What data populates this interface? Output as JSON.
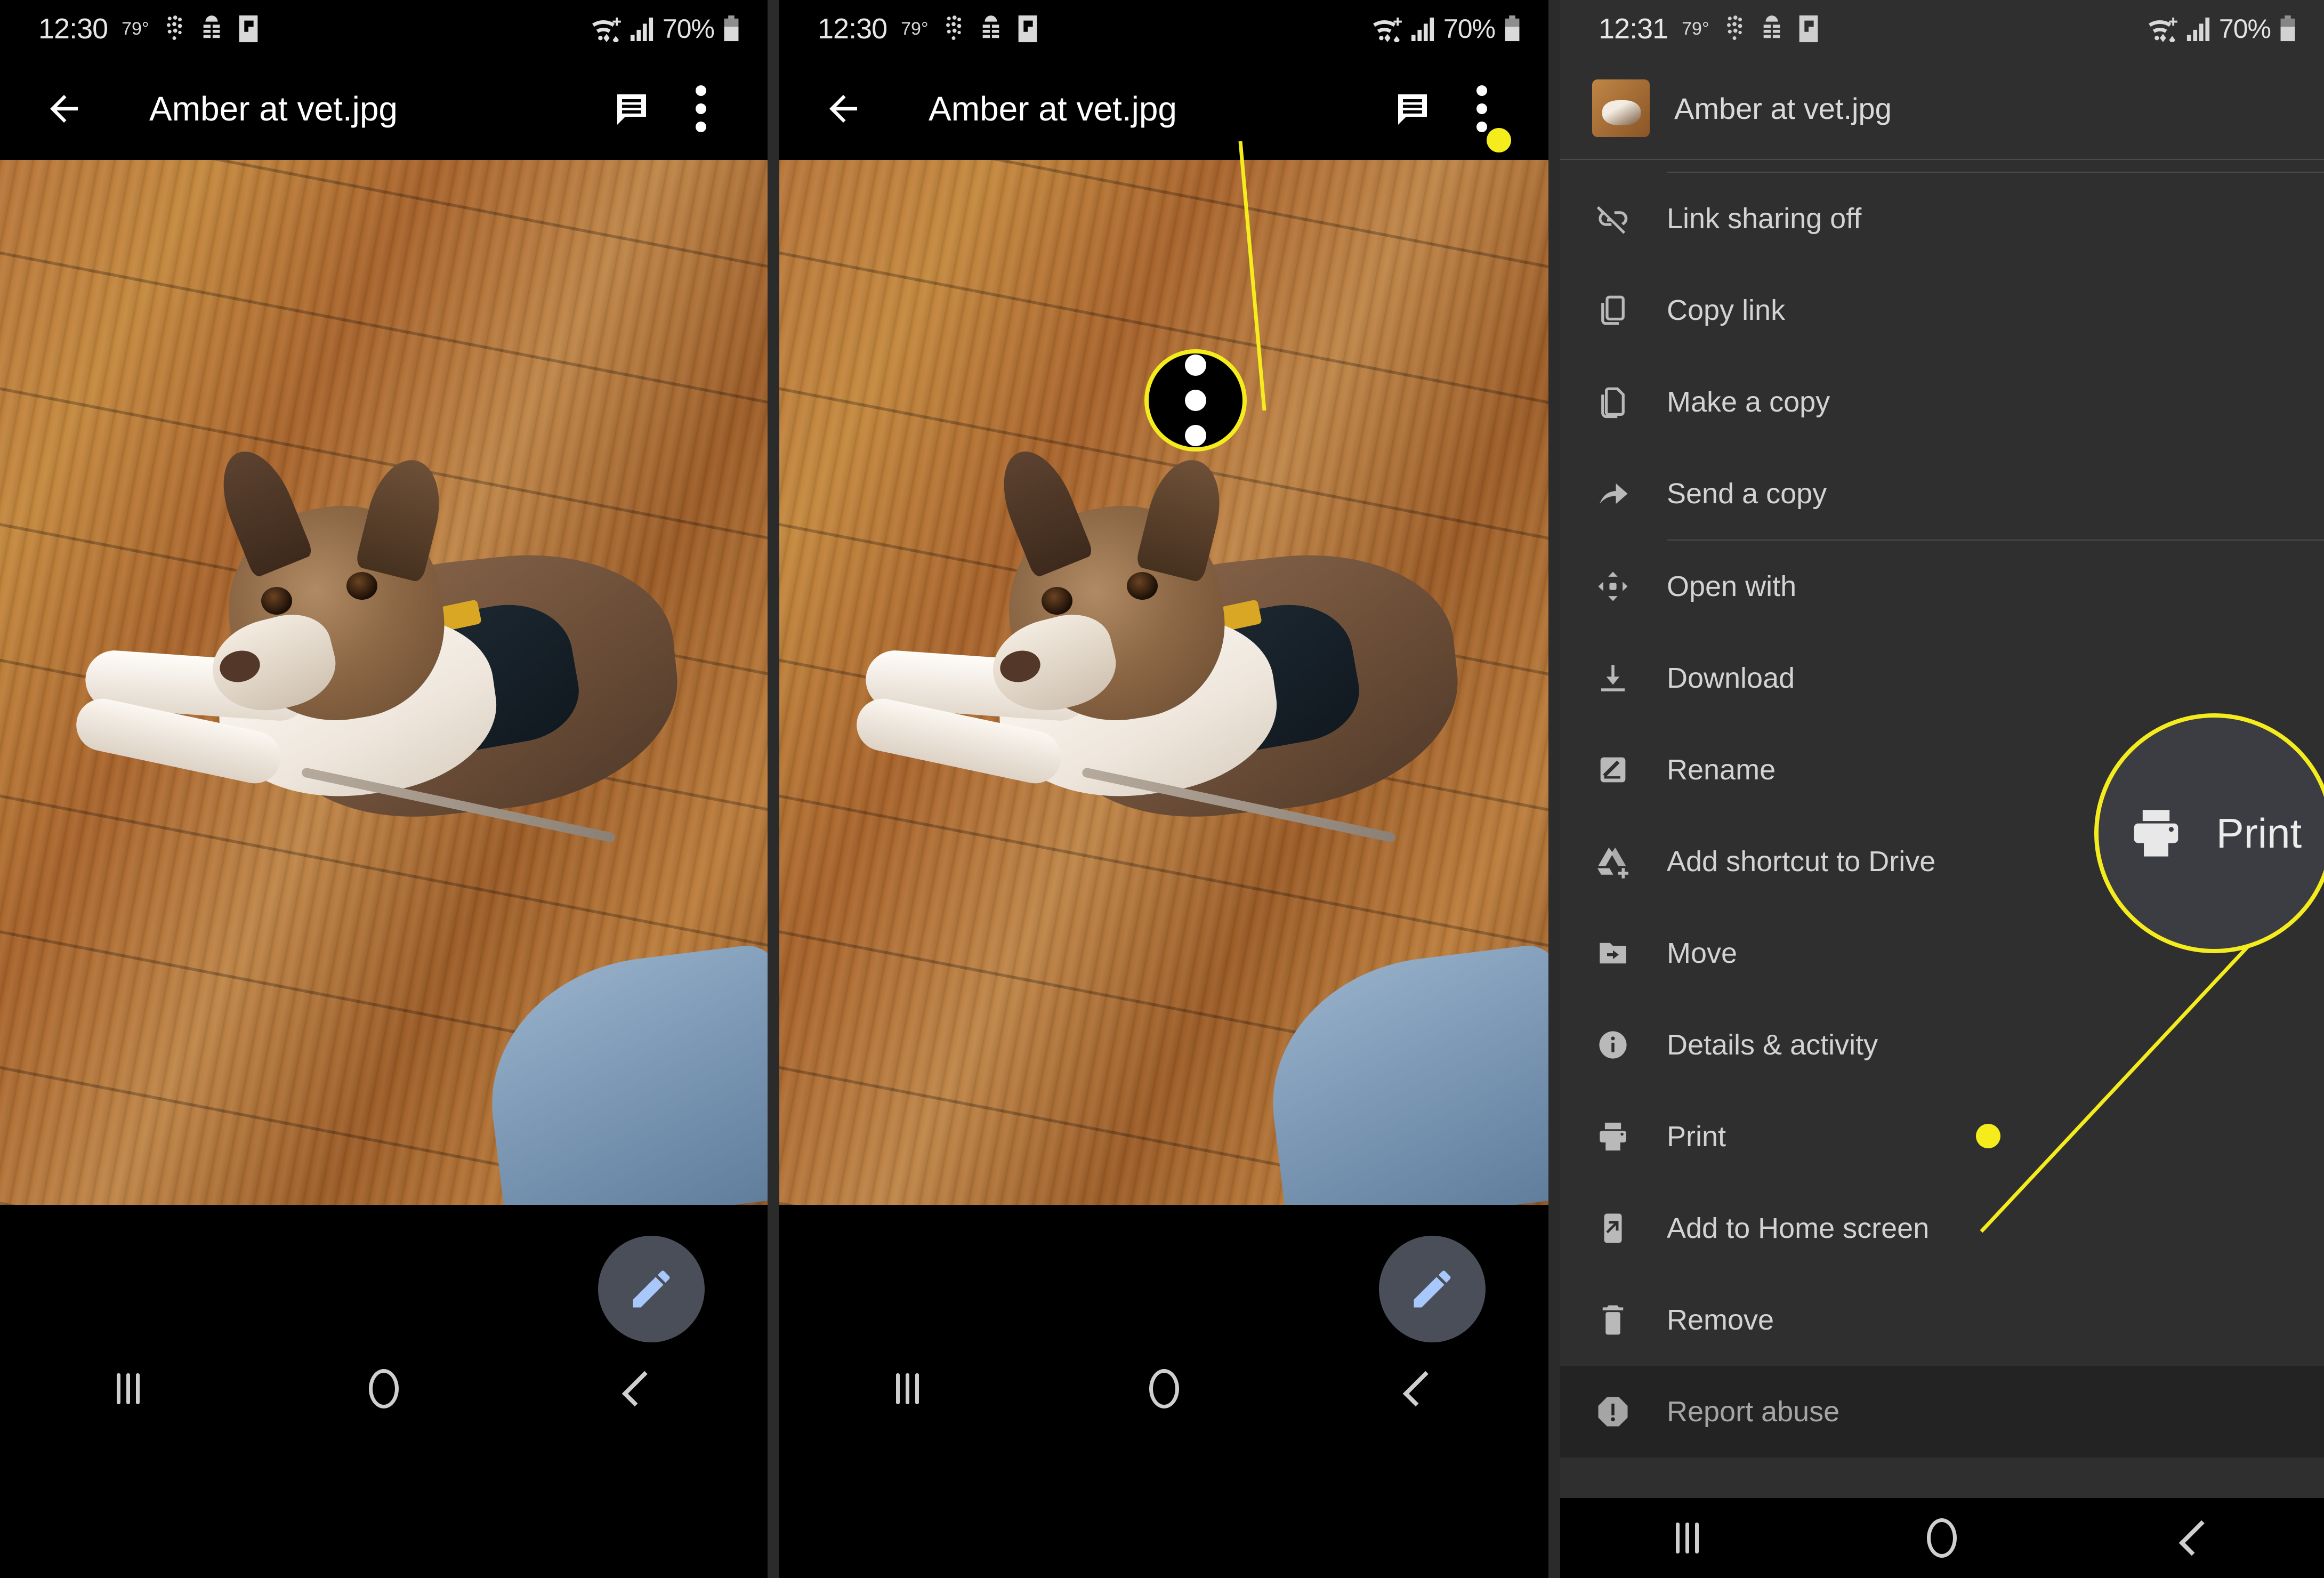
{
  "statusbar": {
    "time_panel1": "12:30",
    "time_panel2": "12:30",
    "time_panel3": "12:31",
    "temperature": "79°",
    "battery": "70%",
    "icons": [
      "braille-dots-icon",
      "android-robot-icon",
      "flipboard-icon",
      "wifi-icon",
      "cellular-signal-icon",
      "battery-icon"
    ]
  },
  "appbar": {
    "title": "Amber at vet.jpg",
    "back_label": "back-arrow",
    "comment_label": "comment",
    "overflow_label": "more-options"
  },
  "fab": {
    "label": "edit"
  },
  "navbar": {
    "recents": "recents",
    "home": "home",
    "back": "back"
  },
  "callouts": {
    "overflow": {
      "label": "more-options-highlight"
    },
    "print": {
      "label": "Print"
    }
  },
  "menu": {
    "header_title": "Amber at vet.jpg",
    "groups": [
      {
        "items": [
          {
            "label": "Link sharing off",
            "icon": "link-off-icon",
            "disabled": false
          },
          {
            "label": "Copy link",
            "icon": "copy-link-icon",
            "disabled": false
          },
          {
            "label": "Make a copy",
            "icon": "make-a-copy-icon",
            "disabled": false
          },
          {
            "label": "Send a copy",
            "icon": "send-a-copy-icon",
            "disabled": false
          }
        ]
      },
      {
        "items": [
          {
            "label": "Open with",
            "icon": "open-with-icon",
            "disabled": false
          },
          {
            "label": "Download",
            "icon": "download-icon",
            "disabled": false
          },
          {
            "label": "Rename",
            "icon": "rename-icon",
            "disabled": false
          },
          {
            "label": "Add shortcut to Drive",
            "icon": "add-shortcut-to-drive-icon",
            "disabled": false
          },
          {
            "label": "Move",
            "icon": "move-icon",
            "disabled": false
          },
          {
            "label": "Details & activity",
            "icon": "info-icon",
            "disabled": false
          },
          {
            "label": "Print",
            "icon": "print-icon",
            "disabled": false
          },
          {
            "label": "Add to Home screen",
            "icon": "add-to-home-screen-icon",
            "disabled": false
          },
          {
            "label": "Remove",
            "icon": "trash-icon",
            "disabled": false
          },
          {
            "label": "Report abuse",
            "icon": "report-abuse-icon",
            "disabled": true
          }
        ]
      }
    ]
  },
  "colors": {
    "highlight": "#f5ec1d",
    "panel_bg": "#2f2f2f",
    "menu_text": "#d3d3d3",
    "fab_bg": "#4a4e58",
    "fab_icon": "#a8c7fa"
  }
}
